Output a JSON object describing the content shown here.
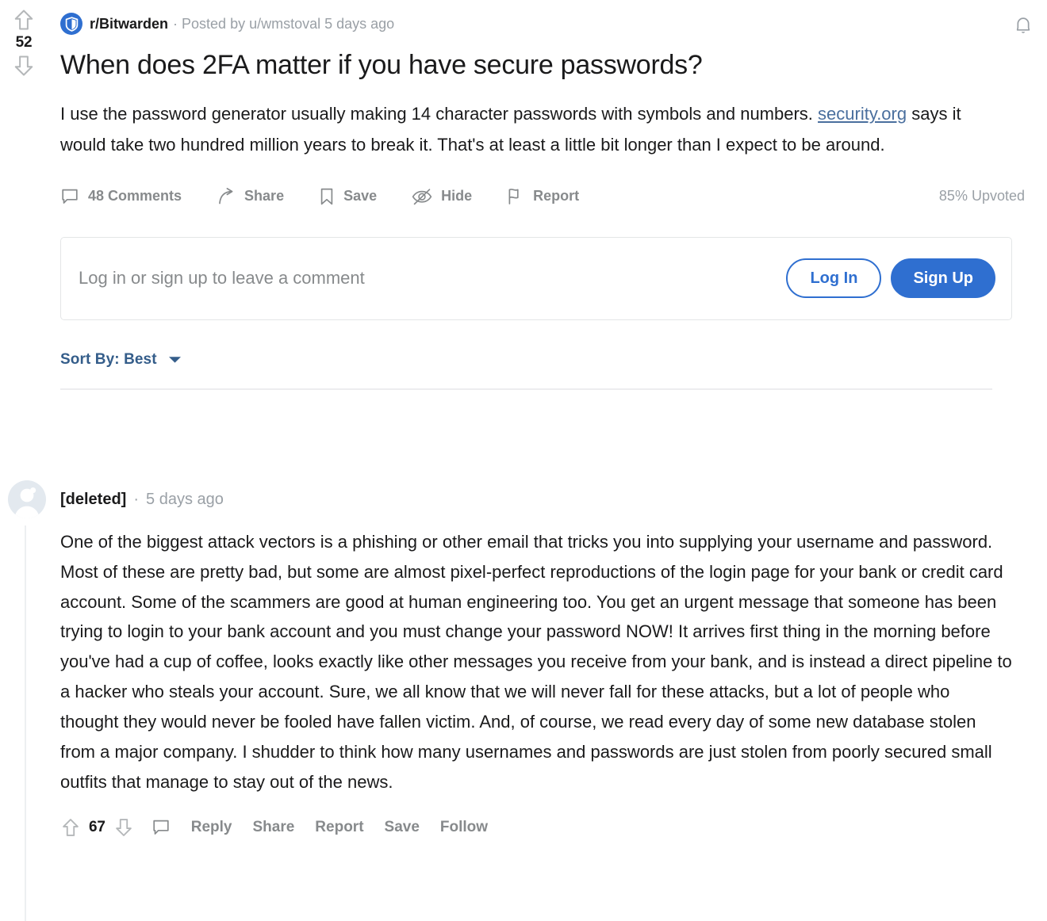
{
  "post": {
    "score": "52",
    "upvote_icon": "upvote-arrow-icon",
    "downvote_icon": "downvote-arrow-icon",
    "subreddit": "r/Bitwarden",
    "subreddit_icon": "bitwarden-shield-icon",
    "byline": "· Posted by u/wmstoval 5 days ago",
    "title": "When does 2FA matter if you have secure passwords?",
    "body_part1": "I use the password generator usually making 14 character passwords with symbols and numbers. ",
    "body_link": "security.org",
    "body_part2": " says it would take two hundred million years to break it. That's at least a little bit longer than I expect to be around.",
    "upvoted_percent": "85% Upvoted"
  },
  "header": {
    "notification_icon": "bell-icon"
  },
  "actions": {
    "comments": "48 Comments",
    "comments_icon": "comment-bubble-icon",
    "share": "Share",
    "share_icon": "share-arrow-icon",
    "save": "Save",
    "save_icon": "bookmark-icon",
    "hide": "Hide",
    "hide_icon": "eye-slash-icon",
    "report": "Report",
    "report_icon": "flag-icon"
  },
  "login_box": {
    "prompt": "Log in or sign up to leave a comment",
    "log_in": "Log In",
    "sign_up": "Sign Up"
  },
  "sort": {
    "label": "Sort By: Best",
    "caret_icon": "chevron-down-icon"
  },
  "comment": {
    "avatar_icon": "default-avatar-icon",
    "author": "[deleted]",
    "separator": "·",
    "time": "5 days ago",
    "body": "One of the biggest attack vectors is a phishing or other email that tricks you into supplying your username and password. Most of these are pretty bad, but some are almost pixel-perfect reproductions of the login page for your bank or credit card account. Some of the scammers are good at human engineering too. You get an urgent message that someone has been trying to login to your bank account and you must change your password NOW! It arrives first thing in the morning before you've had a cup of coffee, looks exactly like other messages you receive from your bank, and is instead a direct pipeline to a hacker who steals your account. Sure, we all know that we will never fall for these attacks, but a lot of people who thought they would never be fooled have fallen victim. And, of course, we read every day of some new database stolen from a major company. I shudder to think how many usernames and passwords are just stolen from poorly secured small outfits that manage to stay out of the news.",
    "score": "67",
    "upvote_icon": "upvote-arrow-icon",
    "downvote_icon": "downvote-arrow-icon",
    "reply_icon": "comment-bubble-icon",
    "reply": "Reply",
    "share": "Share",
    "report": "Report",
    "save": "Save",
    "follow": "Follow"
  },
  "colors": {
    "reddit_blue": "#2f6fd0",
    "sort_blue": "#345d8a",
    "muted_gray": "#878a8c",
    "link_blue": "#4a6f9e",
    "text_dark": "#1a1a1b"
  }
}
